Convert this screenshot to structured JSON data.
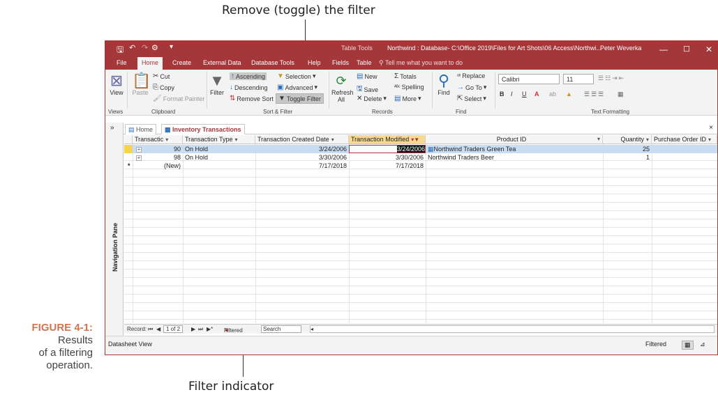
{
  "callouts": {
    "top": "Remove (toggle) the filter",
    "bottom": "Filter indicator"
  },
  "figure": {
    "number": "FIGURE 4-1:",
    "caption_line1": "Results",
    "caption_line2": "of a filtering",
    "caption_line3": "operation."
  },
  "titlebar": {
    "context": "Table Tools",
    "document": "Northwind : Database- C:\\Office 2019\\Files for Art Shots\\06 Access\\Northwi...",
    "user": "Peter Weverka",
    "minimize": "—",
    "maximize": "☐",
    "close": "✕"
  },
  "tabs": {
    "file": "File",
    "home": "Home",
    "create": "Create",
    "external": "External Data",
    "dbtools": "Database Tools",
    "help": "Help",
    "fields": "Fields",
    "table": "Table",
    "tell_me": "Tell me what you want to do"
  },
  "ribbon": {
    "view": "View",
    "paste": "Paste",
    "cut": "Cut",
    "copy": "Copy",
    "format_painter": "Format Painter",
    "filter": "Filter",
    "ascending": "Ascending",
    "descending": "Descending",
    "remove_sort": "Remove Sort",
    "selection": "Selection",
    "advanced": "Advanced",
    "toggle_filter": "Toggle Filter",
    "refresh": "Refresh",
    "refresh_all": "All",
    "new": "New",
    "save": "Save",
    "delete": "Delete",
    "totals": "Totals",
    "spelling": "Spelling",
    "more": "More",
    "find": "Find",
    "replace": "Replace",
    "goto": "Go To",
    "select": "Select",
    "font_name": "Calibri",
    "font_size": "11",
    "bold": "B",
    "italic": "I",
    "underline": "U"
  },
  "groups": {
    "views": "Views",
    "clipboard": "Clipboard",
    "sort_filter": "Sort & Filter",
    "records": "Records",
    "find": "Find",
    "text_formatting": "Text Formatting"
  },
  "nav_pane": {
    "label": "Navigation Pane",
    "toggle": "»"
  },
  "doc_tabs": {
    "home": "Home",
    "active": "Inventory Transactions",
    "close": "×"
  },
  "grid": {
    "columns": [
      "Transactic",
      "Transaction Type",
      "Transaction Created Date",
      "Transaction Modified",
      "Product ID",
      "Quantity",
      "Purchase Order ID"
    ],
    "rows": [
      {
        "id": "90",
        "type": "On Hold",
        "created": "3/24/2006",
        "modified": "3/24/2006",
        "product": "Northwind Traders Green Tea",
        "qty": "25",
        "po": ""
      },
      {
        "id": "98",
        "type": "On Hold",
        "created": "3/30/2006",
        "modified": "3/30/2006",
        "product": "Northwind Traders Beer",
        "qty": "1",
        "po": ""
      }
    ],
    "new_row": {
      "marker": "*",
      "id": "(New)",
      "created": "7/17/2018",
      "modified": "7/17/2018"
    }
  },
  "record_nav": {
    "label": "Record:",
    "position": "1 of 2",
    "filtered": "Filtered",
    "search": "Search"
  },
  "status": {
    "left": "Datasheet View",
    "right": "Filtered"
  },
  "colors": {
    "accent": "#a4373a",
    "highlight": "#f8d990",
    "row_select": "#c9ddf2"
  }
}
